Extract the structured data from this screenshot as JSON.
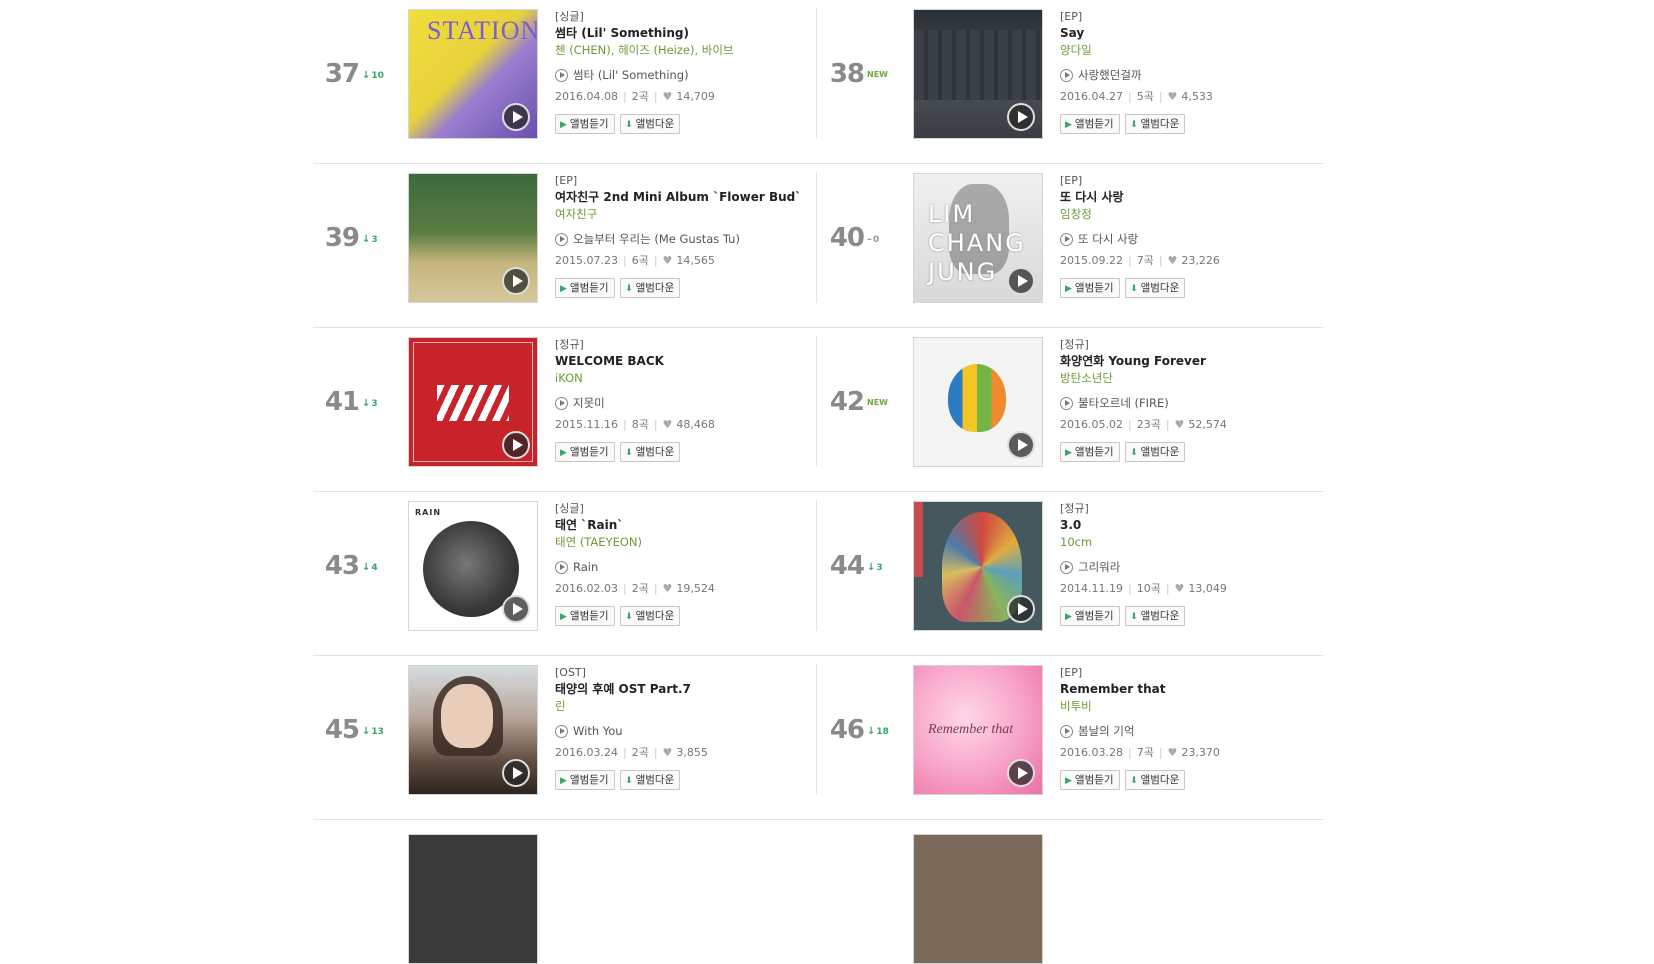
{
  "buttons": {
    "listen": "앨범듣기",
    "download": "앨범다운"
  },
  "icons": {
    "play": "play-icon",
    "heart": "heart-icon",
    "arrow_down": "arrow-down-icon",
    "arrow_up": "arrow-up-icon"
  },
  "colors": {
    "artist": "#6a9c3a",
    "rank": "#8a8a8a",
    "change": "#3aa56a"
  },
  "entries": [
    {
      "rank": "37",
      "change": "10",
      "type": "[싱글]",
      "title": "썸타 (Lil' Something)",
      "artist": "첸 (CHEN), 헤이즈 (Heize), 바이브",
      "track": "썸타 (Lil' Something)",
      "date": "2016.04.08",
      "count": "2곡",
      "likes": "14,709",
      "cover_text": "STATION"
    },
    {
      "rank": "38",
      "change": "NEW",
      "type": "[EP]",
      "title": "Say",
      "artist": "양다일",
      "track": "사랑했던걸까",
      "date": "2016.04.27",
      "count": "5곡",
      "likes": "4,533"
    },
    {
      "rank": "39",
      "change": "3",
      "type": "[EP]",
      "title": "여자친구 2nd Mini Album `Flower Bud`",
      "artist": "여자친구",
      "track": "오늘부터 우리는 (Me Gustas Tu)",
      "date": "2015.07.23",
      "count": "6곡",
      "likes": "14,565"
    },
    {
      "rank": "40",
      "change": "0",
      "type": "[EP]",
      "title": "또 다시 사랑",
      "artist": "임창정",
      "track": "또 다시 사랑",
      "date": "2015.09.22",
      "count": "7곡",
      "likes": "23,226",
      "cover_text": "LIM CHANG JUNG"
    },
    {
      "rank": "41",
      "change": "3",
      "type": "[정규]",
      "title": "WELCOME BACK",
      "artist": "iKON",
      "track": "지못미",
      "date": "2015.11.16",
      "count": "8곡",
      "likes": "48,468"
    },
    {
      "rank": "42",
      "change": "NEW",
      "type": "[정규]",
      "title": "화양연화 Young Forever",
      "artist": "방탄소년단",
      "track": "불타오르네 (FIRE)",
      "date": "2016.05.02",
      "count": "23곡",
      "likes": "52,574"
    },
    {
      "rank": "43",
      "change": "4",
      "type": "[싱글]",
      "title": "태연 `Rain`",
      "artist": "태연 (TAEYEON)",
      "track": "Rain",
      "date": "2016.02.03",
      "count": "2곡",
      "likes": "19,524",
      "cover_text": "RAIN"
    },
    {
      "rank": "44",
      "change": "3",
      "type": "[정규]",
      "title": "3.0",
      "artist": "10cm",
      "track": "그리워라",
      "date": "2014.11.19",
      "count": "10곡",
      "likes": "13,049"
    },
    {
      "rank": "45",
      "change": "13",
      "type": "[OST]",
      "title": "태양의 후예 OST Part.7",
      "artist": "린",
      "track": "With You",
      "date": "2016.03.24",
      "count": "2곡",
      "likes": "3,855"
    },
    {
      "rank": "46",
      "change": "18",
      "type": "[EP]",
      "title": "Remember that",
      "artist": "비투비",
      "track": "봄날의 기억",
      "date": "2016.03.28",
      "count": "7곡",
      "likes": "23,370",
      "cover_text": "Remember that"
    }
  ]
}
